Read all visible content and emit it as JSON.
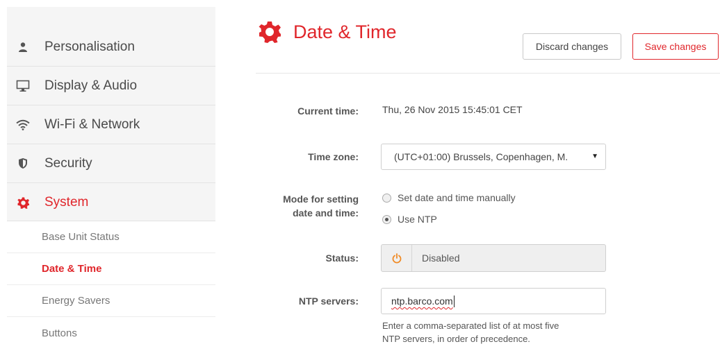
{
  "sidebar": {
    "items": [
      {
        "label": "Personalisation",
        "icon": "person-icon"
      },
      {
        "label": "Display & Audio",
        "icon": "monitor-icon"
      },
      {
        "label": "Wi-Fi & Network",
        "icon": "wifi-icon"
      },
      {
        "label": "Security",
        "icon": "shield-icon"
      },
      {
        "label": "System",
        "icon": "gear-icon",
        "active": true
      }
    ],
    "sub_items": [
      {
        "label": "Base Unit Status"
      },
      {
        "label": "Date & Time",
        "active": true
      },
      {
        "label": "Energy Savers"
      },
      {
        "label": "Buttons"
      }
    ]
  },
  "header": {
    "title": "Date & Time",
    "discard_label": "Discard changes",
    "save_label": "Save changes"
  },
  "form": {
    "current_time_label": "Current time:",
    "current_time_value": "Thu, 26 Nov 2015 15:45:01 CET",
    "time_zone_label": "Time zone:",
    "time_zone_value": "(UTC+01:00) Brussels, Copenhagen, M.",
    "mode_label_1": "Mode for setting",
    "mode_label_2": "date and time:",
    "mode_options": [
      {
        "label": "Set date and time manually",
        "checked": false
      },
      {
        "label": "Use NTP",
        "checked": true
      }
    ],
    "status_label": "Status:",
    "status_value": "Disabled",
    "ntp_label": "NTP servers:",
    "ntp_value": "ntp.barco.com",
    "ntp_help_1": "Enter a comma-separated list of at most five",
    "ntp_help_2": "NTP servers, in order of precedence."
  },
  "colors": {
    "accent": "#e0262b",
    "power_icon": "#f08a24"
  }
}
